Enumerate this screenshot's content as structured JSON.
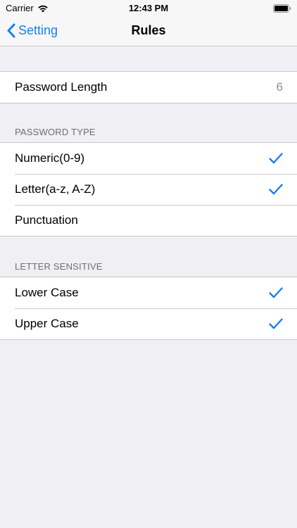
{
  "status_bar": {
    "carrier": "Carrier",
    "time": "12:43 PM"
  },
  "nav": {
    "back_label": "Setting",
    "title": "Rules"
  },
  "length_section": {
    "label": "Password Length",
    "value": "6"
  },
  "password_type": {
    "header": "PASSWORD TYPE",
    "items": [
      {
        "label": "Numeric(0-9)",
        "checked": true
      },
      {
        "label": "Letter(a-z, A-Z)",
        "checked": true
      },
      {
        "label": "Punctuation",
        "checked": false
      }
    ]
  },
  "letter_sensitive": {
    "header": "LETTER SENSITIVE",
    "items": [
      {
        "label": "Lower Case",
        "checked": true
      },
      {
        "label": "Upper Case",
        "checked": true
      }
    ]
  },
  "colors": {
    "accent": "#147efb",
    "background": "#efeff4"
  }
}
